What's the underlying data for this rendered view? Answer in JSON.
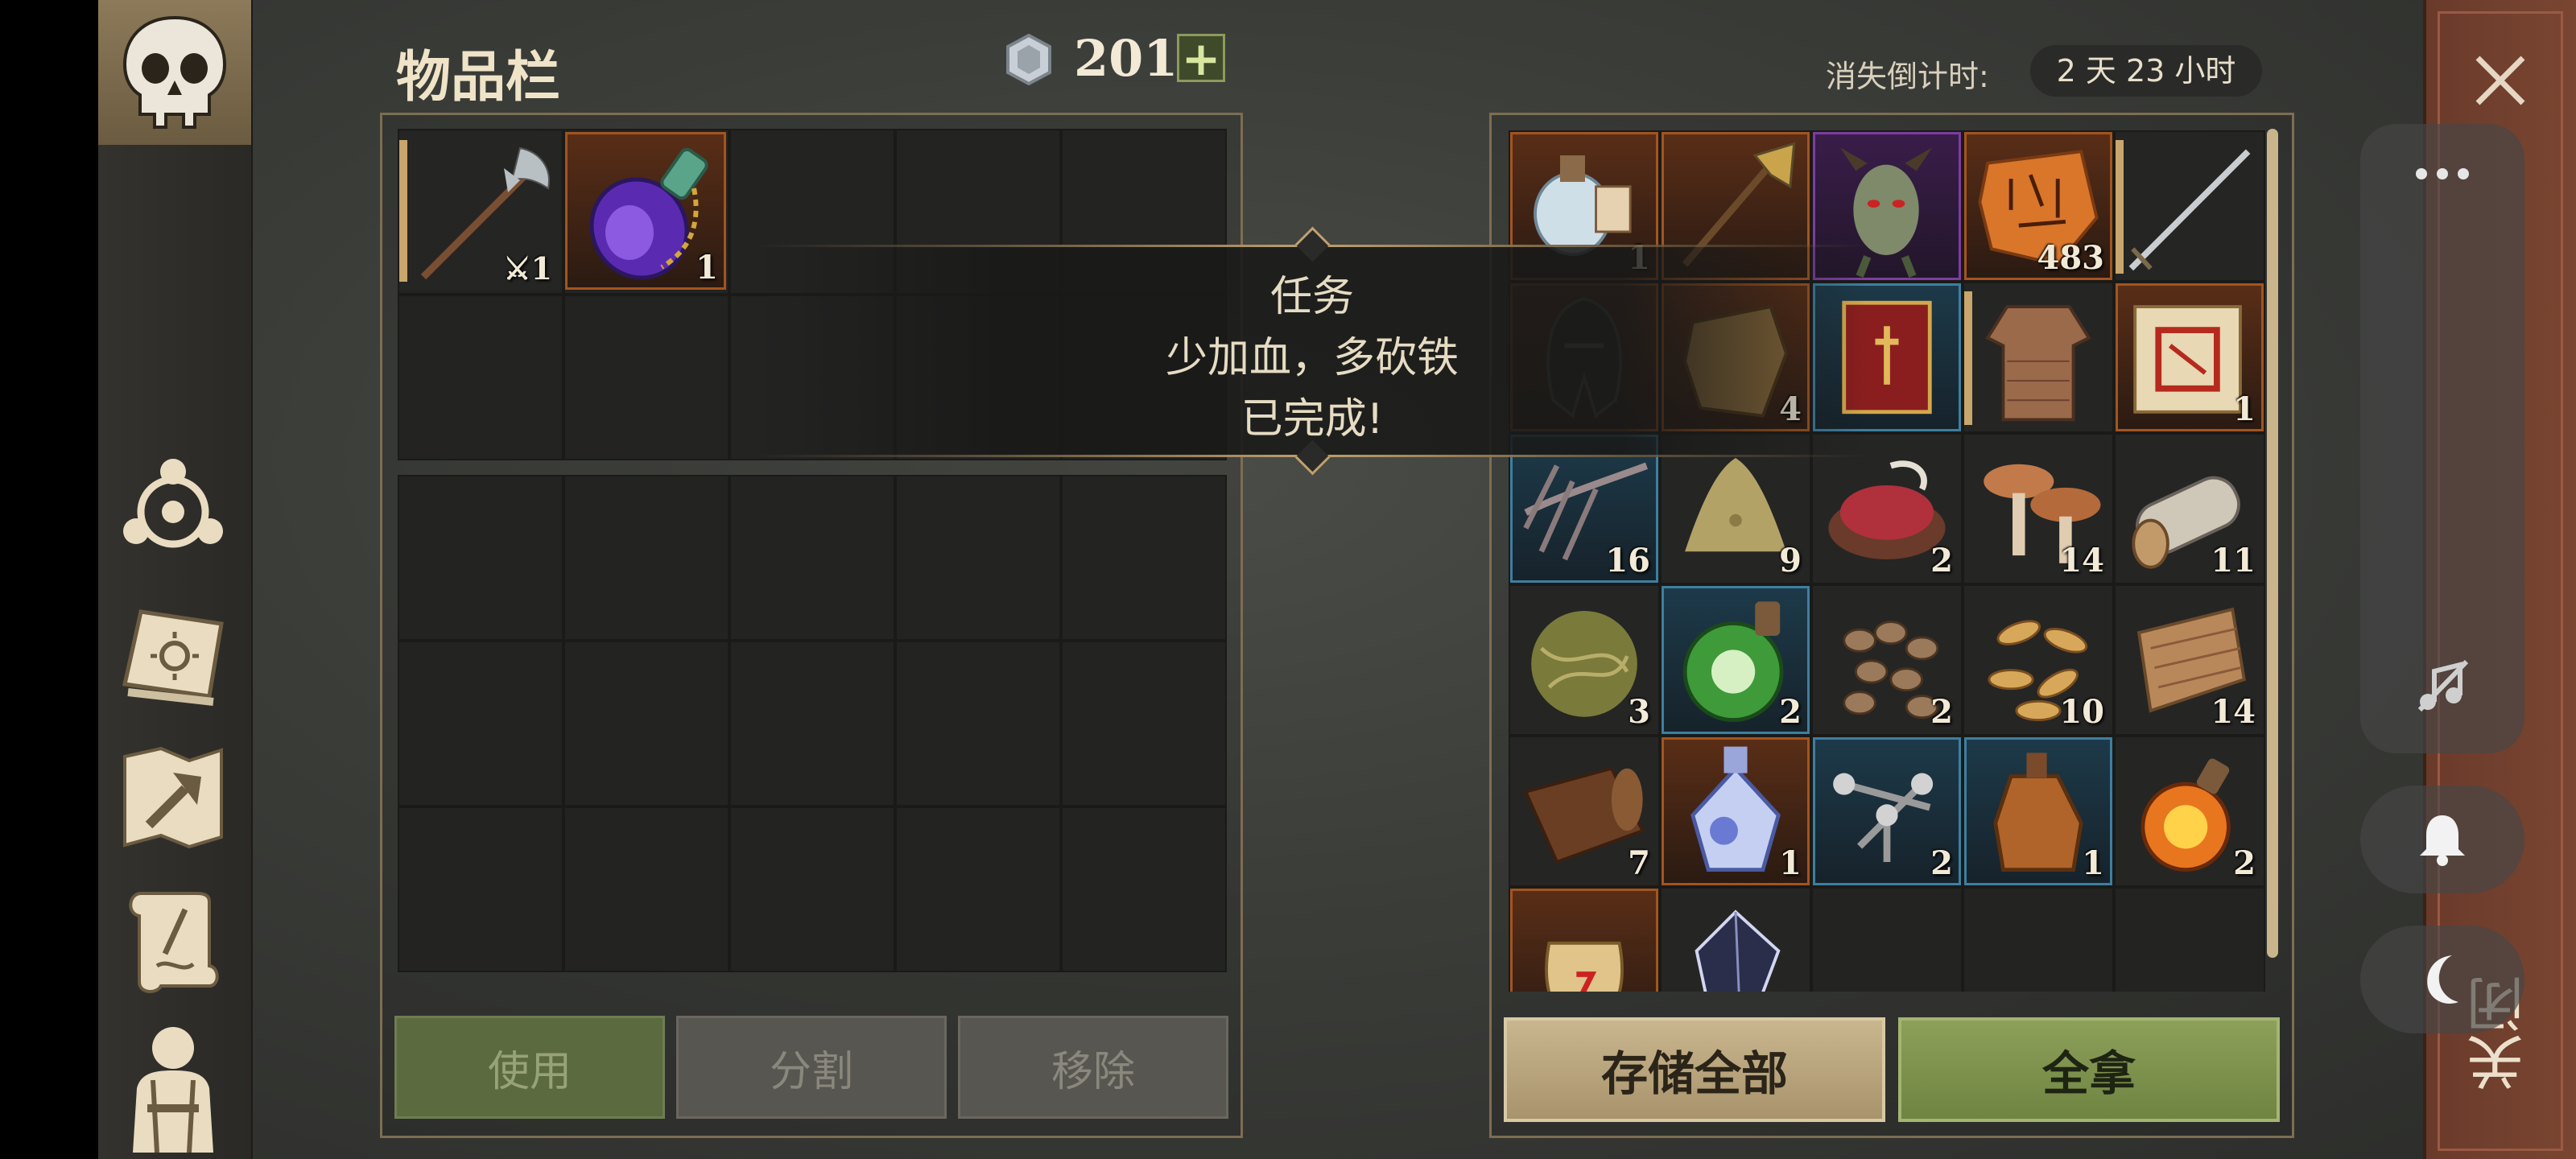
{
  "header": {
    "title": "物品栏",
    "currency": "201",
    "plus": "+",
    "countdown_label": "消失倒计时:",
    "countdown_value": "2 天 23 小时"
  },
  "left_slots": [
    {
      "icon": "halberd-icon",
      "count": "1",
      "rarity": "normal"
    },
    {
      "icon": "purple-potion-icon",
      "count": "1",
      "rarity": "orange"
    }
  ],
  "right_slots": [
    {
      "icon": "water-flask-icon",
      "count": "1",
      "rarity": "orange"
    },
    {
      "icon": "axe-icon",
      "count": "",
      "rarity": "orange"
    },
    {
      "icon": "demon-head-icon",
      "count": "",
      "rarity": "purple"
    },
    {
      "icon": "runestone-icon",
      "count": "483",
      "rarity": "orange"
    },
    {
      "icon": "sword-icon",
      "count": "",
      "rarity": "normal"
    },
    {
      "icon": "helmet-icon",
      "count": "",
      "rarity": "orange"
    },
    {
      "icon": "leather-scrap-icon",
      "count": "4",
      "rarity": "orange"
    },
    {
      "icon": "red-book-icon",
      "count": "",
      "rarity": "blue"
    },
    {
      "icon": "chainmail-icon",
      "count": "",
      "rarity": "normal"
    },
    {
      "icon": "recipe-scroll-icon",
      "count": "1",
      "rarity": "orange"
    },
    {
      "icon": "claws-icon",
      "count": "16",
      "rarity": "blue"
    },
    {
      "icon": "powder-pile-icon",
      "count": "9",
      "rarity": "normal"
    },
    {
      "icon": "raw-meat-icon",
      "count": "2",
      "rarity": "normal"
    },
    {
      "icon": "mushroom-icon",
      "count": "14",
      "rarity": "normal"
    },
    {
      "icon": "log-icon",
      "count": "11",
      "rarity": "normal"
    },
    {
      "icon": "fiber-ball-icon",
      "count": "3",
      "rarity": "normal"
    },
    {
      "icon": "green-potion-icon",
      "count": "2",
      "rarity": "blue"
    },
    {
      "icon": "beans-icon",
      "count": "2",
      "rarity": "normal"
    },
    {
      "icon": "seeds-icon",
      "count": "10",
      "rarity": "normal"
    },
    {
      "icon": "cloth-icon",
      "count": "14",
      "rarity": "normal"
    },
    {
      "icon": "leather-roll-icon",
      "count": "7",
      "rarity": "normal"
    },
    {
      "icon": "crystal-flask-icon",
      "count": "1",
      "rarity": "orange"
    },
    {
      "icon": "nails-icon",
      "count": "2",
      "rarity": "blue"
    },
    {
      "icon": "jug-icon",
      "count": "1",
      "rarity": "blue"
    },
    {
      "icon": "fire-flask-icon",
      "count": "2",
      "rarity": "normal"
    },
    {
      "icon": "pouch-icon",
      "count": "",
      "rarity": "orange"
    },
    {
      "icon": "dark-crystal-icon",
      "count": "",
      "rarity": "normal"
    }
  ],
  "toast": {
    "line1": "任务",
    "line2": "少加血，多砍铁",
    "line3": "已完成!"
  },
  "buttons": {
    "use": "使用",
    "split": "分割",
    "remove": "移除",
    "store_all": "存储全部",
    "take_all": "全拿"
  },
  "right_edge_text": "关闭",
  "colors": {
    "rarity_orange": "#a4541e",
    "rarity_blue": "#3d7fa0",
    "rarity_purple": "#7d3da0",
    "take_green": "#7d9150",
    "store_tan": "#bca882"
  }
}
